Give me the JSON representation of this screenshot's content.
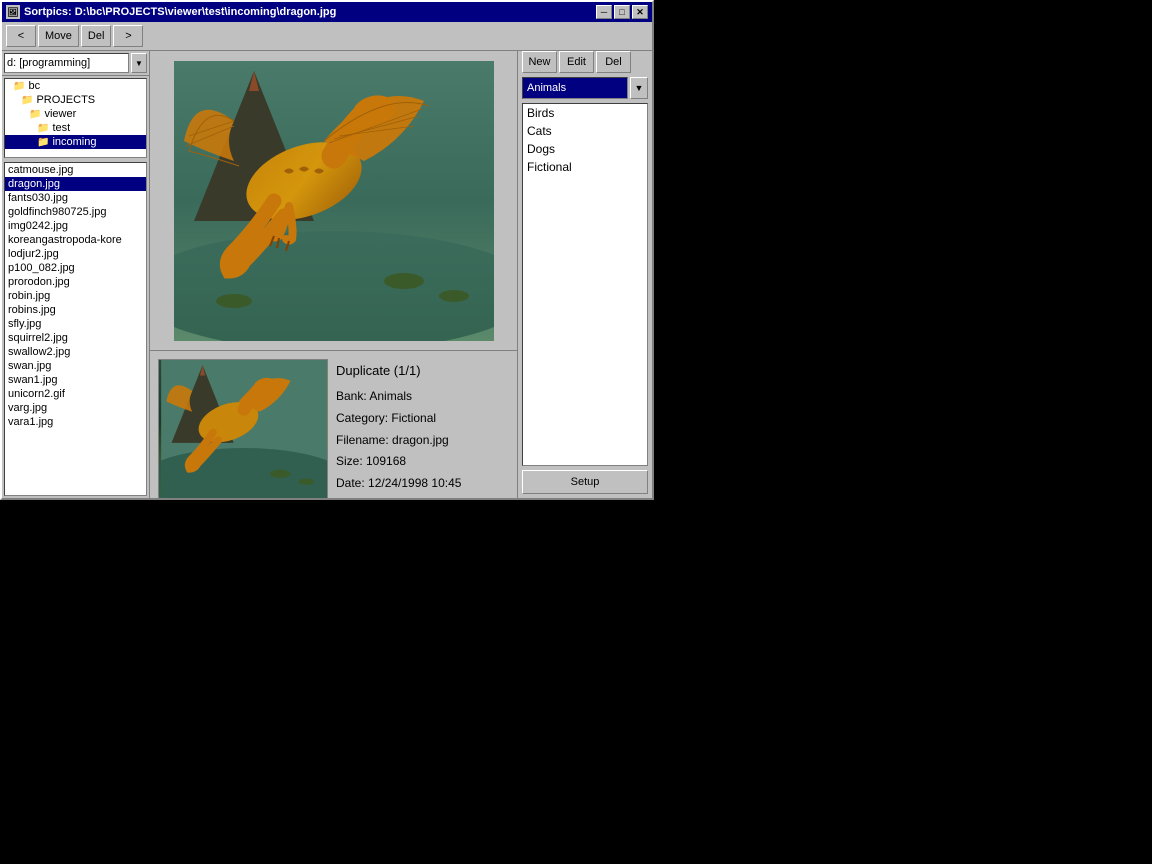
{
  "window": {
    "title": "Sortpics: D:\\bc\\PROJECTS\\viewer\\test\\incoming\\dragon.jpg",
    "icon": "🖼"
  },
  "titlebar_buttons": {
    "minimize": "─",
    "maximize": "□",
    "close": "✕"
  },
  "toolbar": {
    "back_label": "<",
    "move_label": "Move",
    "del_label": "Del",
    "forward_label": ">"
  },
  "drive_selector": {
    "value": "d: [programming]",
    "arrow": "▼"
  },
  "directory_tree": [
    {
      "label": "bc",
      "indent": 1,
      "icon": "📁"
    },
    {
      "label": "PROJECTS",
      "indent": 2,
      "icon": "📁"
    },
    {
      "label": "viewer",
      "indent": 3,
      "icon": "📁"
    },
    {
      "label": "test",
      "indent": 4,
      "icon": "📁"
    },
    {
      "label": "incoming",
      "indent": 5,
      "icon": "📁",
      "selected": true
    }
  ],
  "files": [
    {
      "name": "catmouse.jpg"
    },
    {
      "name": "dragon.jpg",
      "selected": true
    },
    {
      "name": "fants030.jpg"
    },
    {
      "name": "goldfinch980725.jpg"
    },
    {
      "name": "img0242.jpg"
    },
    {
      "name": "koreangastropoda-kore"
    },
    {
      "name": "lodjur2.jpg"
    },
    {
      "name": "p100_082.jpg"
    },
    {
      "name": "prorodon.jpg"
    },
    {
      "name": "robin.jpg"
    },
    {
      "name": "robins.jpg"
    },
    {
      "name": "sfly.jpg"
    },
    {
      "name": "squirrel2.jpg"
    },
    {
      "name": "swallow2.jpg"
    },
    {
      "name": "swan.jpg"
    },
    {
      "name": "swan1.jpg"
    },
    {
      "name": "unicorn2.gif"
    },
    {
      "name": "varg.jpg"
    },
    {
      "name": "vara1.jpg"
    }
  ],
  "category_buttons": {
    "new_label": "New",
    "edit_label": "Edit",
    "del_label": "Del"
  },
  "bank_dropdown": {
    "value": "Animals",
    "arrow": "▼"
  },
  "categories": [
    {
      "name": "Birds"
    },
    {
      "name": "Cats"
    },
    {
      "name": "Dogs"
    },
    {
      "name": "Fictional"
    }
  ],
  "setup_button": {
    "label": "Setup"
  },
  "duplicate": {
    "title": "Duplicate (1/1)",
    "bank": "Bank: Animals",
    "category": "Category: Fictional",
    "filename": "Filename: dragon.jpg",
    "size": "Size: 109168",
    "date": "Date: 12/24/1998 10:45",
    "minus_label": "-",
    "plus_label": "+"
  }
}
